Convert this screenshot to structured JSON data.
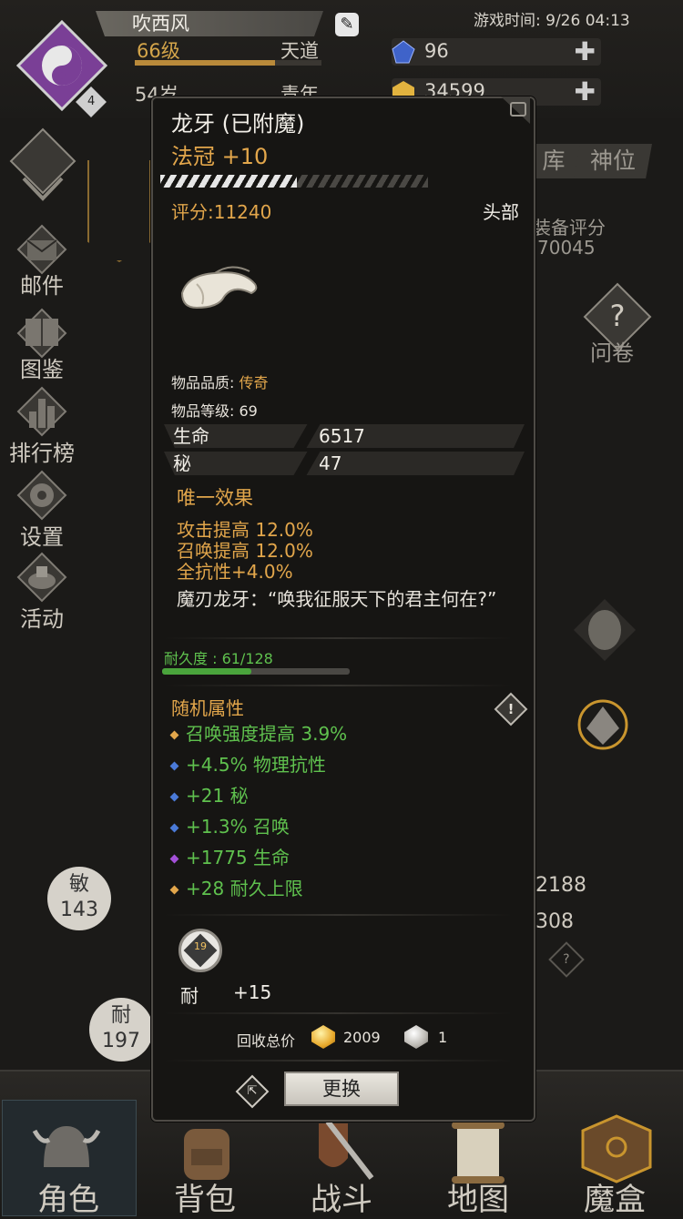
{
  "player": {
    "name": "吹西风",
    "level": "66级",
    "realm": "天道",
    "age": "54岁",
    "age_stage": "青年",
    "avatar_badge": "4",
    "exp_fraction": 0.75
  },
  "header": {
    "game_time": "游戏时间: 9/26 04:13",
    "gems": "96",
    "gold": "34599"
  },
  "side_menu": [
    {
      "label": "邮件",
      "icon": "mail-icon"
    },
    {
      "label": "图鉴",
      "icon": "book-icon"
    },
    {
      "label": "排行榜",
      "icon": "ranking-icon"
    },
    {
      "label": "设置",
      "icon": "gear-icon"
    },
    {
      "label": "活动",
      "icon": "event-icon"
    }
  ],
  "right_panel": {
    "tabs": [
      "库",
      "神位"
    ],
    "equip_score_label": "装备评分",
    "equip_score": "70045",
    "survey_label": "问卷",
    "stat_right_1": "2188",
    "stat_right_2": "308"
  },
  "stat_circles": [
    {
      "label": "敏",
      "value": "143"
    },
    {
      "label": "耐",
      "value": "197"
    }
  ],
  "bottom_nav": [
    {
      "label": "角色",
      "icon": "helmet-icon"
    },
    {
      "label": "背包",
      "icon": "backpack-icon"
    },
    {
      "label": "战斗",
      "icon": "sword-shield-icon"
    },
    {
      "label": "地图",
      "icon": "scroll-map-icon"
    },
    {
      "label": "魔盒",
      "icon": "magic-box-icon"
    }
  ],
  "item": {
    "name": "龙牙 (已附魔)",
    "type": "法冠 +10",
    "rating": "评分:11240",
    "slot": "头部",
    "quality_label": "物品品质: ",
    "quality_value": "传奇",
    "item_level": "物品等级: 69",
    "base_stats": [
      {
        "key": "生命",
        "value": "6517"
      },
      {
        "key": "秘",
        "value": "47"
      }
    ],
    "unique_title": "唯一效果",
    "unique_effects": [
      "攻击提高 12.0%",
      "召唤提高 12.0%",
      "全抗性+4.0%"
    ],
    "quote": "魔刃龙牙：“唤我征服天下的君主何在?”",
    "durability_label": "耐久度 : 61/128",
    "durability_fraction": 0.477,
    "random_title": "随机属性",
    "random_stats": [
      {
        "text": "召唤强度提高 3.9%",
        "color": "#e2a64b"
      },
      {
        "text": "+4.5% 物理抗性",
        "color": "#4a7ad8"
      },
      {
        "text": "+21 秘",
        "color": "#4a7ad8"
      },
      {
        "text": "+1.3% 召唤",
        "color": "#4a7ad8"
      },
      {
        "text": "+1775 生命",
        "color": "#a350d8"
      },
      {
        "text": "+28 耐久上限",
        "color": "#e2a64b"
      }
    ],
    "rune_number": "19",
    "socket_stat_key": "耐",
    "socket_stat_value": "+15",
    "recycle_label": "回收总价",
    "recycle_gold": "2009",
    "recycle_silver": "1",
    "replace_label": "更换"
  },
  "colors": {
    "accent_orange": "#e2a64b",
    "green": "#5fc14e",
    "panel_bg": "#161513"
  }
}
